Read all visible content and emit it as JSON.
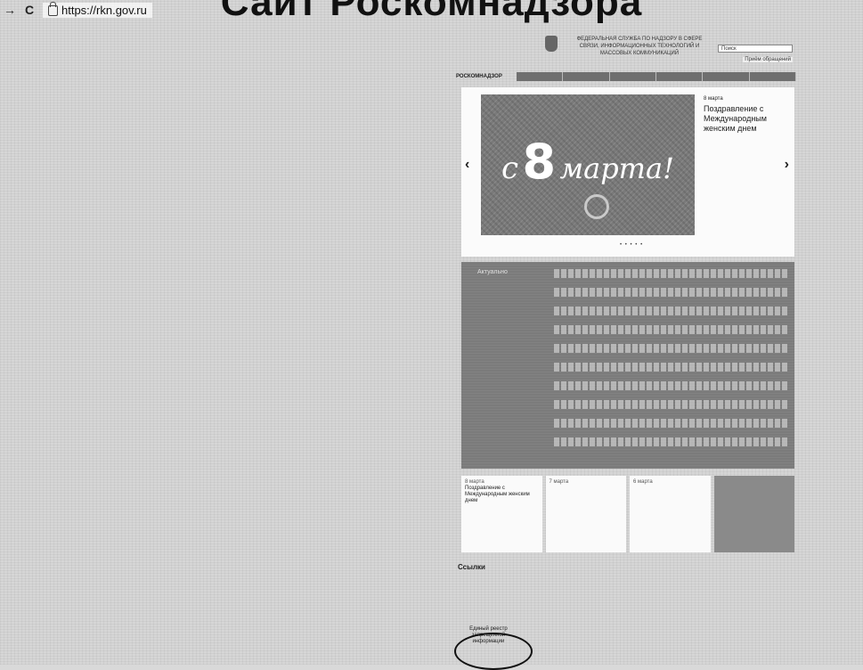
{
  "page_title": "Сайт Роскомнадзора",
  "browser": {
    "back_icon": "arrow-right-icon",
    "reload_icon": "reload-icon",
    "url": "https://rkn.gov.ru"
  },
  "site": {
    "agency_name": "ФЕДЕРАЛЬНАЯ СЛУЖБА ПО НАДЗОРУ В СФЕРЕ СВЯЗИ, ИНФОРМАЦИОННЫХ ТЕХНОЛОГИЙ И МАССОВЫХ КОММУНИКАЦИЙ",
    "logo": "РОСКОМНАДЗОР",
    "search_placeholder": "Поиск",
    "reception_link": "Приём обращений"
  },
  "slider": {
    "slide_text_c": "с",
    "slide_text_num": "8",
    "slide_text_month": "марта!",
    "caption_date": "8 марта",
    "caption_title": "Поздравление с Международным женским днем"
  },
  "news": {
    "heading": "Актуально"
  },
  "cards": [
    {
      "date": "8 марта",
      "title": "Поздравление с Международным женским днем"
    },
    {
      "date": "7 марта",
      "title": ""
    },
    {
      "date": "6 марта",
      "title": ""
    }
  ],
  "links": {
    "title": "Ссылки",
    "row1": [
      "",
      "",
      "",
      "",
      ""
    ],
    "row2": [
      "Единый реестр запрещенной информации",
      "",
      "",
      "",
      ""
    ]
  }
}
